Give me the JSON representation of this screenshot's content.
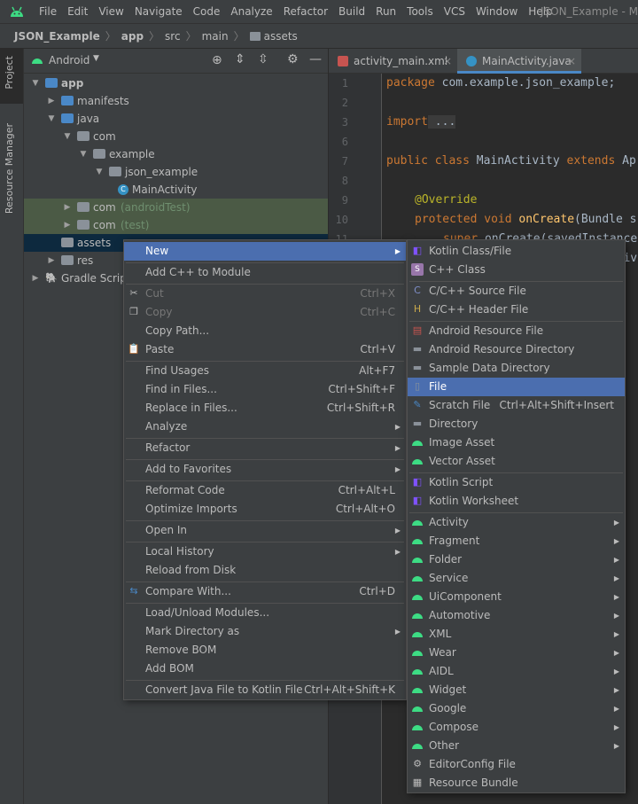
{
  "menubar": {
    "items": [
      "File",
      "Edit",
      "View",
      "Navigate",
      "Code",
      "Analyze",
      "Refactor",
      "Build",
      "Run",
      "Tools",
      "VCS",
      "Window",
      "Help"
    ],
    "window_title": "JSON_Example - Ma"
  },
  "breadcrumb": [
    "JSON_Example",
    "app",
    "src",
    "main",
    "assets"
  ],
  "side_tabs": {
    "project": "Project",
    "resource_manager": "Resource Manager"
  },
  "project": {
    "view_selector": "Android",
    "tree": [
      {
        "label": "app",
        "depth": 0,
        "arrow": "down",
        "icon": "module-folder",
        "bold": true
      },
      {
        "label": "manifests",
        "depth": 1,
        "arrow": "right",
        "icon": "folder"
      },
      {
        "label": "java",
        "depth": 1,
        "arrow": "down",
        "icon": "folder"
      },
      {
        "label": "com",
        "depth": 2,
        "arrow": "down",
        "icon": "package"
      },
      {
        "label": "example",
        "depth": 3,
        "arrow": "down",
        "icon": "package"
      },
      {
        "label": "json_example",
        "depth": 4,
        "arrow": "down",
        "icon": "package"
      },
      {
        "label": "MainActivity",
        "depth": 5,
        "arrow": "",
        "icon": "class"
      },
      {
        "label": "com",
        "suffix": "(androidTest)",
        "depth": 2,
        "arrow": "right",
        "icon": "package",
        "hl": true
      },
      {
        "label": "com",
        "suffix": "(test)",
        "depth": 2,
        "arrow": "right",
        "icon": "package",
        "hl": true
      },
      {
        "label": "assets",
        "depth": 1,
        "arrow": "",
        "icon": "res-folder",
        "sel": true
      },
      {
        "label": "res",
        "depth": 1,
        "arrow": "right",
        "icon": "res-folder"
      },
      {
        "label": "Gradle Scripts",
        "depth": 0,
        "arrow": "right",
        "icon": "gradle"
      }
    ]
  },
  "editor": {
    "tabs": [
      {
        "label": "activity_main.xml",
        "active": false
      },
      {
        "label": "MainActivity.java",
        "active": true
      }
    ],
    "line_numbers": [
      "1",
      "2",
      "3",
      "6",
      "7",
      "8",
      "9",
      "10",
      "11"
    ],
    "code": {
      "l1_kw": "package",
      "l1_rest": " com.example.json_example;",
      "l3_kw": "import",
      "l3_rest": " ...",
      "l7_kw1": "public class",
      "l7_name": " MainActivity ",
      "l7_kw2": "extends",
      "l7_rest": " Ap",
      "l9_ann": "@Override",
      "l10_kw": "protected void",
      "l10_fn": " onCreate",
      "l10_rest": "(Bundle s",
      "l11_kw": "super",
      "l11_rest": ".onCreate(savedInstance",
      "l12_rest": "activ"
    }
  },
  "context_menu": [
    {
      "label": "New",
      "shortcut": "",
      "sub": true,
      "active": true,
      "icon": ""
    },
    {
      "sep": true
    },
    {
      "label": "Add C++ to Module",
      "shortcut": "",
      "icon": ""
    },
    {
      "sep": true
    },
    {
      "label": "Cut",
      "shortcut": "Ctrl+X",
      "disabled": true,
      "icon": "scissors-icon"
    },
    {
      "label": "Copy",
      "shortcut": "Ctrl+C",
      "disabled": true,
      "icon": "copy-icon"
    },
    {
      "label": "Copy Path...",
      "shortcut": "",
      "icon": ""
    },
    {
      "label": "Paste",
      "shortcut": "Ctrl+V",
      "icon": "paste-icon"
    },
    {
      "sep": true
    },
    {
      "label": "Find Usages",
      "shortcut": "Alt+F7",
      "icon": ""
    },
    {
      "label": "Find in Files...",
      "shortcut": "Ctrl+Shift+F",
      "icon": ""
    },
    {
      "label": "Replace in Files...",
      "shortcut": "Ctrl+Shift+R",
      "icon": ""
    },
    {
      "label": "Analyze",
      "shortcut": "",
      "sub": true,
      "icon": ""
    },
    {
      "sep": true
    },
    {
      "label": "Refactor",
      "shortcut": "",
      "sub": true,
      "icon": ""
    },
    {
      "sep": true
    },
    {
      "label": "Add to Favorites",
      "shortcut": "",
      "sub": true,
      "icon": ""
    },
    {
      "sep": true
    },
    {
      "label": "Reformat Code",
      "shortcut": "Ctrl+Alt+L",
      "icon": ""
    },
    {
      "label": "Optimize Imports",
      "shortcut": "Ctrl+Alt+O",
      "icon": ""
    },
    {
      "sep": true
    },
    {
      "label": "Open In",
      "shortcut": "",
      "sub": true,
      "icon": ""
    },
    {
      "sep": true
    },
    {
      "label": "Local History",
      "shortcut": "",
      "sub": true,
      "icon": ""
    },
    {
      "label": "Reload from Disk",
      "shortcut": "",
      "icon": "reload-icon"
    },
    {
      "sep": true
    },
    {
      "label": "Compare With...",
      "shortcut": "Ctrl+D",
      "icon": "compare-icon"
    },
    {
      "sep": true
    },
    {
      "label": "Load/Unload Modules...",
      "shortcut": "",
      "icon": ""
    },
    {
      "label": "Mark Directory as",
      "shortcut": "",
      "sub": true,
      "icon": ""
    },
    {
      "label": "Remove BOM",
      "shortcut": "",
      "icon": ""
    },
    {
      "label": "Add BOM",
      "shortcut": "",
      "icon": ""
    },
    {
      "sep": true
    },
    {
      "label": "Convert Java File to Kotlin File",
      "shortcut": "Ctrl+Alt+Shift+K",
      "icon": ""
    }
  ],
  "new_submenu": [
    {
      "label": "Kotlin Class/File",
      "shortcut": "",
      "icon": "kotlin-icon"
    },
    {
      "label": "C++ Class",
      "shortcut": "",
      "icon": "cpp-class-icon"
    },
    {
      "sep": true
    },
    {
      "label": "C/C++ Source File",
      "shortcut": "",
      "icon": "cpp-source-icon"
    },
    {
      "label": "C/C++ Header File",
      "shortcut": "",
      "icon": "cpp-header-icon"
    },
    {
      "sep": true
    },
    {
      "label": "Android Resource File",
      "shortcut": "",
      "icon": "resource-file-icon"
    },
    {
      "label": "Android Resource Directory",
      "shortcut": "",
      "icon": "folder-icon"
    },
    {
      "label": "Sample Data Directory",
      "shortcut": "",
      "icon": "folder-icon"
    },
    {
      "label": "File",
      "shortcut": "",
      "active": true,
      "icon": "file-icon"
    },
    {
      "label": "Scratch File",
      "shortcut": "Ctrl+Alt+Shift+Insert",
      "icon": "scratch-icon"
    },
    {
      "label": "Directory",
      "shortcut": "",
      "icon": "folder-icon"
    },
    {
      "label": "Image Asset",
      "shortcut": "",
      "icon": "android-icon"
    },
    {
      "label": "Vector Asset",
      "shortcut": "",
      "icon": "android-icon"
    },
    {
      "sep": true
    },
    {
      "label": "Kotlin Script",
      "shortcut": "",
      "icon": "kotlin-script-icon"
    },
    {
      "label": "Kotlin Worksheet",
      "shortcut": "",
      "icon": "kotlin-script-icon"
    },
    {
      "sep": true
    },
    {
      "label": "Activity",
      "shortcut": "",
      "sub": true,
      "icon": "android-icon"
    },
    {
      "label": "Fragment",
      "shortcut": "",
      "sub": true,
      "icon": "android-icon"
    },
    {
      "label": "Folder",
      "shortcut": "",
      "sub": true,
      "icon": "android-icon"
    },
    {
      "label": "Service",
      "shortcut": "",
      "sub": true,
      "icon": "android-icon"
    },
    {
      "label": "UiComponent",
      "shortcut": "",
      "sub": true,
      "icon": "android-icon"
    },
    {
      "label": "Automotive",
      "shortcut": "",
      "sub": true,
      "icon": "android-icon"
    },
    {
      "label": "XML",
      "shortcut": "",
      "sub": true,
      "icon": "android-icon"
    },
    {
      "label": "Wear",
      "shortcut": "",
      "sub": true,
      "icon": "android-icon"
    },
    {
      "label": "AIDL",
      "shortcut": "",
      "sub": true,
      "icon": "android-icon"
    },
    {
      "label": "Widget",
      "shortcut": "",
      "sub": true,
      "icon": "android-icon"
    },
    {
      "label": "Google",
      "shortcut": "",
      "sub": true,
      "icon": "android-icon"
    },
    {
      "label": "Compose",
      "shortcut": "",
      "sub": true,
      "icon": "android-icon"
    },
    {
      "label": "Other",
      "shortcut": "",
      "sub": true,
      "icon": "android-icon"
    },
    {
      "label": "EditorConfig File",
      "shortcut": "",
      "icon": "gear-icon"
    },
    {
      "label": "Resource Bundle",
      "shortcut": "",
      "icon": "bundle-icon"
    }
  ],
  "colors": {
    "accent": "#4b6eaf",
    "android_green": "#3ddc84",
    "keyword": "#cc7832",
    "annotation": "#bbb529",
    "function": "#ffc66d"
  }
}
